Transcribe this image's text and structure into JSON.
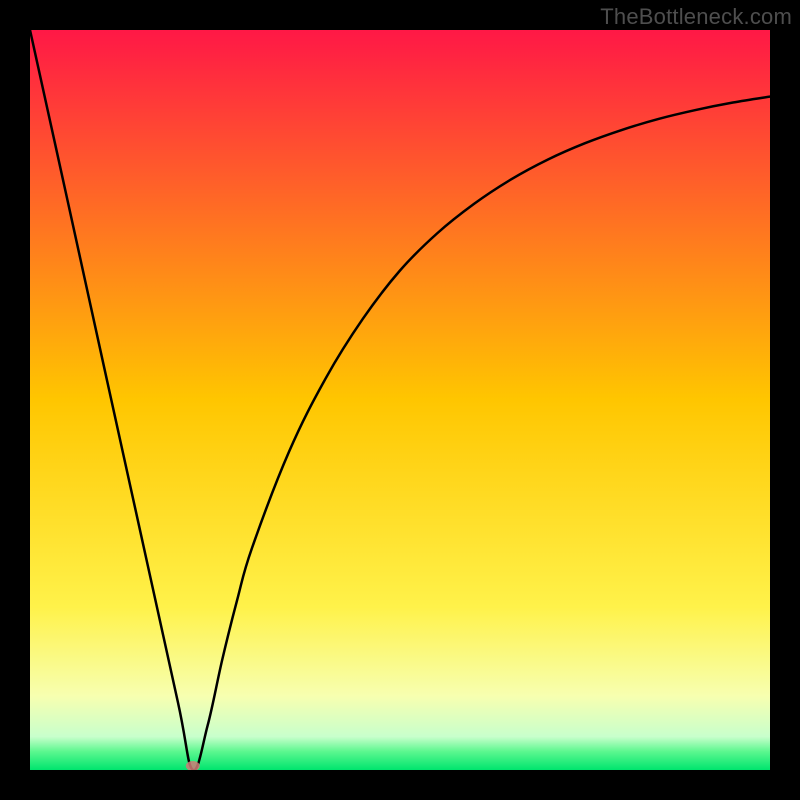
{
  "watermark": "TheBottleneck.com",
  "chart_data": {
    "type": "line",
    "title": "",
    "xlabel": "",
    "ylabel": "",
    "xlim": [
      0,
      100
    ],
    "ylim": [
      0,
      100
    ],
    "grid": false,
    "legend": false,
    "annotations": [],
    "gradient_stops": [
      {
        "pos": 0,
        "color": "#ff1846"
      },
      {
        "pos": 0.5,
        "color": "#ffc600"
      },
      {
        "pos": 0.78,
        "color": "#fff24a"
      },
      {
        "pos": 0.9,
        "color": "#f7ffb0"
      },
      {
        "pos": 0.955,
        "color": "#c8ffcc"
      },
      {
        "pos": 0.975,
        "color": "#5cf78f"
      },
      {
        "pos": 1,
        "color": "#00e56e"
      }
    ],
    "series": [
      {
        "name": "bottleneck-curve",
        "x": [
          0,
          5,
          10,
          15,
          20,
          22,
          24,
          26,
          28,
          30,
          35,
          40,
          45,
          50,
          55,
          60,
          65,
          70,
          75,
          80,
          85,
          90,
          95,
          100
        ],
        "y": [
          100,
          77.3,
          54.5,
          31.8,
          9.1,
          0,
          6,
          15,
          23,
          30,
          43,
          53,
          61,
          67.5,
          72.5,
          76.5,
          79.8,
          82.5,
          84.7,
          86.5,
          88,
          89.2,
          90.2,
          91
        ]
      }
    ],
    "marker": {
      "x": 22,
      "y": 0
    }
  }
}
